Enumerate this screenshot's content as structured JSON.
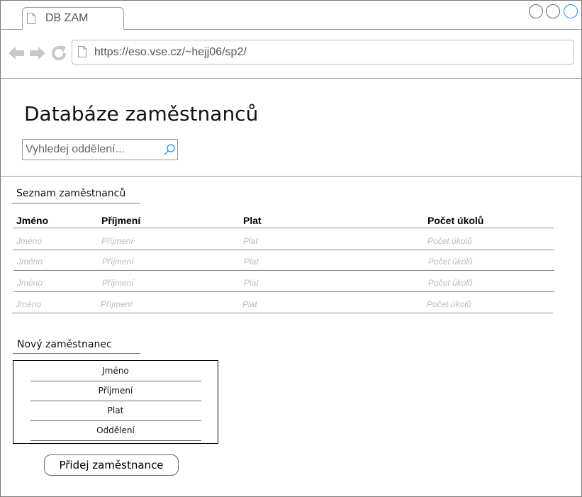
{
  "browser": {
    "tab_title": "DB ZAM",
    "url": "https://eso.vse.cz/~hejj06/sp2/"
  },
  "page": {
    "title": "Databáze zaměstnanců",
    "search_placeholder": "Vyhledej oddělení..."
  },
  "employees": {
    "section_label": "Seznam zaměstnanců",
    "columns": [
      "Jméno",
      "Příjmení",
      "Plat",
      "Počet úkolů"
    ],
    "rows": [
      [
        "Jméno",
        "Příjmení",
        "Plat",
        "Počet úkolů"
      ],
      [
        "Jméno",
        "Příjmení",
        "Plat",
        "Počet úkolů"
      ],
      [
        "Jméno",
        "Příjmení",
        "Plat",
        "Počet úkolů"
      ],
      [
        "Jméno",
        "Příjmení",
        "Plat",
        "Počet úkolů"
      ]
    ]
  },
  "new_employee": {
    "section_label": "Nový zaměstnanec",
    "fields": [
      "Jméno",
      "Příjmení",
      "Plat",
      "Oddělení"
    ],
    "submit_label": "Přidej zaměstnance"
  },
  "colors": {
    "active_window_button": "#1e90ff",
    "placeholder_text": "#bdbdbd"
  },
  "icons": [
    "document-icon",
    "back-arrow-icon",
    "forward-arrow-icon",
    "reload-icon",
    "search-icon",
    "window-button-icon"
  ]
}
